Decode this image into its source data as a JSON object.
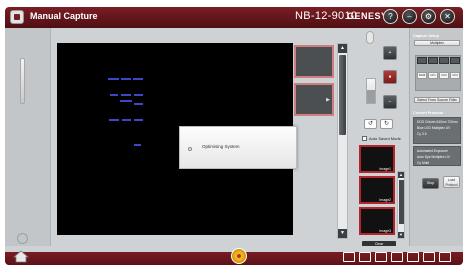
{
  "titlebar": {
    "title": "Manual Capture",
    "model": "NB-12-9010",
    "brand": "GENESYS",
    "window_buttons": [
      "help-icon",
      "minimize-icon",
      "settings-icon",
      "close-icon"
    ]
  },
  "viewer": {
    "dialog_text": "Optimising System"
  },
  "controls": {
    "auto_saved_label": "Auto Saved Mode"
  },
  "captures": {
    "items": [
      {
        "label": "Image1"
      },
      {
        "label": "Image2"
      },
      {
        "label": "Image3"
      }
    ],
    "scroll_label": "Clear"
  },
  "right_panel": {
    "capture_setup_label": "Capture Setup",
    "application_value": "Multiplex",
    "grid_labels": [
      "RGB",
      "Ch1",
      "Ch2",
      "Ch3"
    ],
    "select_button_label": "Select From Source Filter",
    "current_protocol_label": "Current Protocol",
    "protocol_lines": [
      "DOS Chlorin 640nm 720nm",
      "Blue LED Multiplex UV",
      "Cy 3.5",
      "Automated Exposure",
      "Auto Dye Multiplex UV",
      "Cy Multi"
    ],
    "stop_label": "Stop",
    "auto_button_label": "Load Protocol"
  },
  "colors": {
    "accent": "#7a1e24",
    "selection": "#b0262c",
    "blob": "#3b47c8"
  }
}
